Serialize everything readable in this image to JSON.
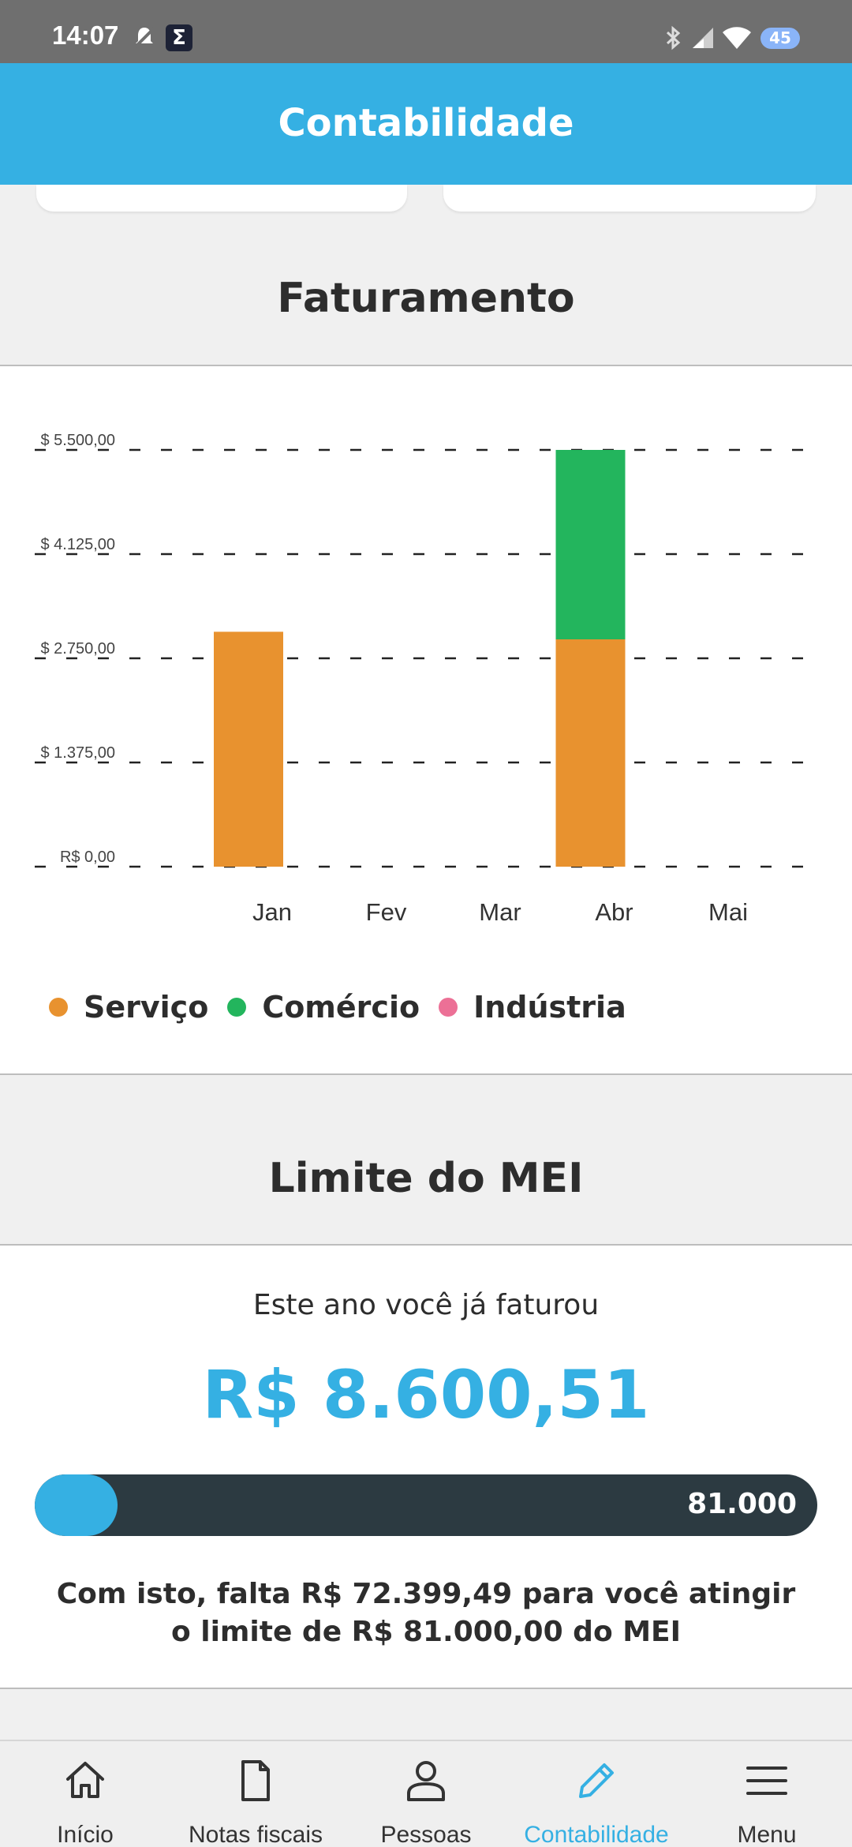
{
  "status_bar": {
    "time": "14:07",
    "battery": "45",
    "icons": [
      "notification-off-icon",
      "sigma-app-icon",
      "bluetooth-icon",
      "signal-icon",
      "wifi-icon",
      "battery-icon"
    ]
  },
  "app_bar": {
    "title": "Contabilidade"
  },
  "faturamento": {
    "title": "Faturamento",
    "legend": [
      {
        "label": "Serviço",
        "color": "#e8922f"
      },
      {
        "label": "Comércio",
        "color": "#23b55d"
      },
      {
        "label": "Indústria",
        "color": "#ec7096"
      }
    ]
  },
  "chart_data": {
    "type": "bar",
    "stacked": true,
    "categories": [
      "Jan",
      "Fev",
      "Mar",
      "Abr",
      "Mai"
    ],
    "y_tick_labels": [
      "R$ 0,00",
      "$ 1.375,00",
      "$ 2.750,00",
      "$ 4.125,00",
      "$ 5.500,00"
    ],
    "y_ticks": [
      0,
      1375,
      2750,
      4125,
      5500
    ],
    "ylim": [
      0,
      5500
    ],
    "grid": "dashed horizontal",
    "legend_position": "bottom-left",
    "series": [
      {
        "name": "Serviço",
        "color": "#e8922f",
        "values": [
          3100,
          0,
          0,
          3000,
          0
        ]
      },
      {
        "name": "Comércio",
        "color": "#23b55d",
        "values": [
          0,
          0,
          0,
          2500,
          0
        ]
      },
      {
        "name": "Indústria",
        "color": "#ec7096",
        "values": [
          0,
          0,
          0,
          0,
          0
        ]
      }
    ]
  },
  "limite": {
    "title": "Limite do MEI",
    "subtitle": "Este ano você já faturou",
    "amount": "R$ 8.600,51",
    "progress_fraction": 0.106,
    "progress_max_label": "81.000",
    "message_line1": "Com isto, falta R$ 72.399,49 para você atingir",
    "message_line2": "o limite de R$ 81.000,00 do MEI"
  },
  "bottom_nav": {
    "items": [
      {
        "label": "Início",
        "icon": "home-icon"
      },
      {
        "label": "Notas fiscais",
        "icon": "document-icon"
      },
      {
        "label": "Pessoas",
        "icon": "person-icon"
      },
      {
        "label": "Contabilidade",
        "icon": "pencil-icon",
        "active": true
      },
      {
        "label": "Menu",
        "icon": "menu-icon"
      }
    ]
  },
  "colors": {
    "accent": "#35b0e3",
    "progress_track": "#2c3a41"
  }
}
